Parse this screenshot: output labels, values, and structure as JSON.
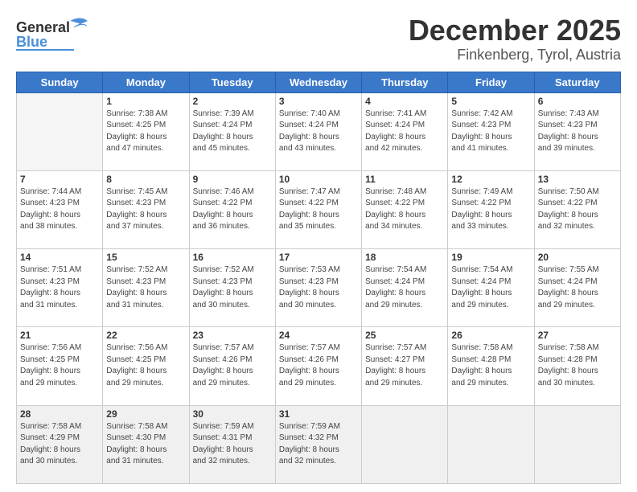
{
  "header": {
    "logo_general": "General",
    "logo_blue": "Blue",
    "title": "December 2025",
    "subtitle": "Finkenberg, Tyrol, Austria"
  },
  "days_of_week": [
    "Sunday",
    "Monday",
    "Tuesday",
    "Wednesday",
    "Thursday",
    "Friday",
    "Saturday"
  ],
  "weeks": [
    [
      {
        "day": "",
        "info": ""
      },
      {
        "day": "1",
        "info": "Sunrise: 7:38 AM\nSunset: 4:25 PM\nDaylight: 8 hours\nand 47 minutes."
      },
      {
        "day": "2",
        "info": "Sunrise: 7:39 AM\nSunset: 4:24 PM\nDaylight: 8 hours\nand 45 minutes."
      },
      {
        "day": "3",
        "info": "Sunrise: 7:40 AM\nSunset: 4:24 PM\nDaylight: 8 hours\nand 43 minutes."
      },
      {
        "day": "4",
        "info": "Sunrise: 7:41 AM\nSunset: 4:24 PM\nDaylight: 8 hours\nand 42 minutes."
      },
      {
        "day": "5",
        "info": "Sunrise: 7:42 AM\nSunset: 4:23 PM\nDaylight: 8 hours\nand 41 minutes."
      },
      {
        "day": "6",
        "info": "Sunrise: 7:43 AM\nSunset: 4:23 PM\nDaylight: 8 hours\nand 39 minutes."
      }
    ],
    [
      {
        "day": "7",
        "info": "Sunrise: 7:44 AM\nSunset: 4:23 PM\nDaylight: 8 hours\nand 38 minutes."
      },
      {
        "day": "8",
        "info": "Sunrise: 7:45 AM\nSunset: 4:23 PM\nDaylight: 8 hours\nand 37 minutes."
      },
      {
        "day": "9",
        "info": "Sunrise: 7:46 AM\nSunset: 4:22 PM\nDaylight: 8 hours\nand 36 minutes."
      },
      {
        "day": "10",
        "info": "Sunrise: 7:47 AM\nSunset: 4:22 PM\nDaylight: 8 hours\nand 35 minutes."
      },
      {
        "day": "11",
        "info": "Sunrise: 7:48 AM\nSunset: 4:22 PM\nDaylight: 8 hours\nand 34 minutes."
      },
      {
        "day": "12",
        "info": "Sunrise: 7:49 AM\nSunset: 4:22 PM\nDaylight: 8 hours\nand 33 minutes."
      },
      {
        "day": "13",
        "info": "Sunrise: 7:50 AM\nSunset: 4:22 PM\nDaylight: 8 hours\nand 32 minutes."
      }
    ],
    [
      {
        "day": "14",
        "info": "Sunrise: 7:51 AM\nSunset: 4:23 PM\nDaylight: 8 hours\nand 31 minutes."
      },
      {
        "day": "15",
        "info": "Sunrise: 7:52 AM\nSunset: 4:23 PM\nDaylight: 8 hours\nand 31 minutes."
      },
      {
        "day": "16",
        "info": "Sunrise: 7:52 AM\nSunset: 4:23 PM\nDaylight: 8 hours\nand 30 minutes."
      },
      {
        "day": "17",
        "info": "Sunrise: 7:53 AM\nSunset: 4:23 PM\nDaylight: 8 hours\nand 30 minutes."
      },
      {
        "day": "18",
        "info": "Sunrise: 7:54 AM\nSunset: 4:24 PM\nDaylight: 8 hours\nand 29 minutes."
      },
      {
        "day": "19",
        "info": "Sunrise: 7:54 AM\nSunset: 4:24 PM\nDaylight: 8 hours\nand 29 minutes."
      },
      {
        "day": "20",
        "info": "Sunrise: 7:55 AM\nSunset: 4:24 PM\nDaylight: 8 hours\nand 29 minutes."
      }
    ],
    [
      {
        "day": "21",
        "info": "Sunrise: 7:56 AM\nSunset: 4:25 PM\nDaylight: 8 hours\nand 29 minutes."
      },
      {
        "day": "22",
        "info": "Sunrise: 7:56 AM\nSunset: 4:25 PM\nDaylight: 8 hours\nand 29 minutes."
      },
      {
        "day": "23",
        "info": "Sunrise: 7:57 AM\nSunset: 4:26 PM\nDaylight: 8 hours\nand 29 minutes."
      },
      {
        "day": "24",
        "info": "Sunrise: 7:57 AM\nSunset: 4:26 PM\nDaylight: 8 hours\nand 29 minutes."
      },
      {
        "day": "25",
        "info": "Sunrise: 7:57 AM\nSunset: 4:27 PM\nDaylight: 8 hours\nand 29 minutes."
      },
      {
        "day": "26",
        "info": "Sunrise: 7:58 AM\nSunset: 4:28 PM\nDaylight: 8 hours\nand 29 minutes."
      },
      {
        "day": "27",
        "info": "Sunrise: 7:58 AM\nSunset: 4:28 PM\nDaylight: 8 hours\nand 30 minutes."
      }
    ],
    [
      {
        "day": "28",
        "info": "Sunrise: 7:58 AM\nSunset: 4:29 PM\nDaylight: 8 hours\nand 30 minutes."
      },
      {
        "day": "29",
        "info": "Sunrise: 7:58 AM\nSunset: 4:30 PM\nDaylight: 8 hours\nand 31 minutes."
      },
      {
        "day": "30",
        "info": "Sunrise: 7:59 AM\nSunset: 4:31 PM\nDaylight: 8 hours\nand 32 minutes."
      },
      {
        "day": "31",
        "info": "Sunrise: 7:59 AM\nSunset: 4:32 PM\nDaylight: 8 hours\nand 32 minutes."
      },
      {
        "day": "",
        "info": ""
      },
      {
        "day": "",
        "info": ""
      },
      {
        "day": "",
        "info": ""
      }
    ]
  ]
}
